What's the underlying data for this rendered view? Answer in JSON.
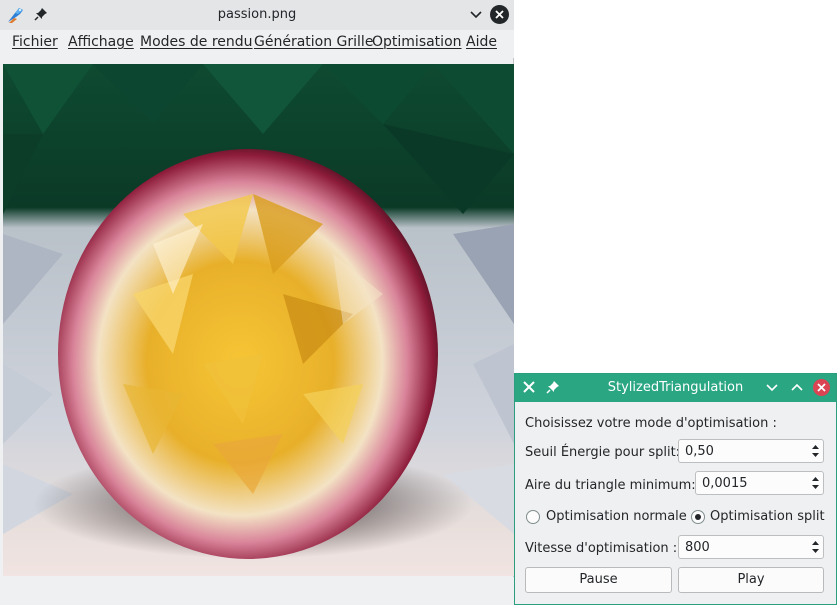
{
  "main_window": {
    "title": "passion.png",
    "menu": [
      {
        "label": "Fichier"
      },
      {
        "label": "Affichage"
      },
      {
        "label": "Modes de rendu"
      },
      {
        "label": "Génération Grille"
      },
      {
        "label": "Optimisation"
      },
      {
        "label": "Aide"
      }
    ],
    "icons": {
      "app": "kingfisher-app-icon",
      "pin": "pin-icon",
      "minimize": "chevron-down-icon",
      "close": "close-icon"
    }
  },
  "dialog": {
    "title": "StylizedTriangulation",
    "heading": "Choisissez votre mode d'optimisation :",
    "split_threshold": {
      "label": "Seuil Énergie pour split:",
      "value": "0,50"
    },
    "min_area": {
      "label": "Aire du triangle minimum:",
      "value": "0,0015"
    },
    "modes": [
      {
        "label": "Optimisation normale",
        "selected": false
      },
      {
        "label": "Optimisation split",
        "selected": true
      }
    ],
    "speed": {
      "label": "Vitesse d'optimisation :",
      "value": "800"
    },
    "pause_label": "Pause",
    "play_label": "Play",
    "title_color": "#2aa683",
    "close_color": "#da4453"
  }
}
